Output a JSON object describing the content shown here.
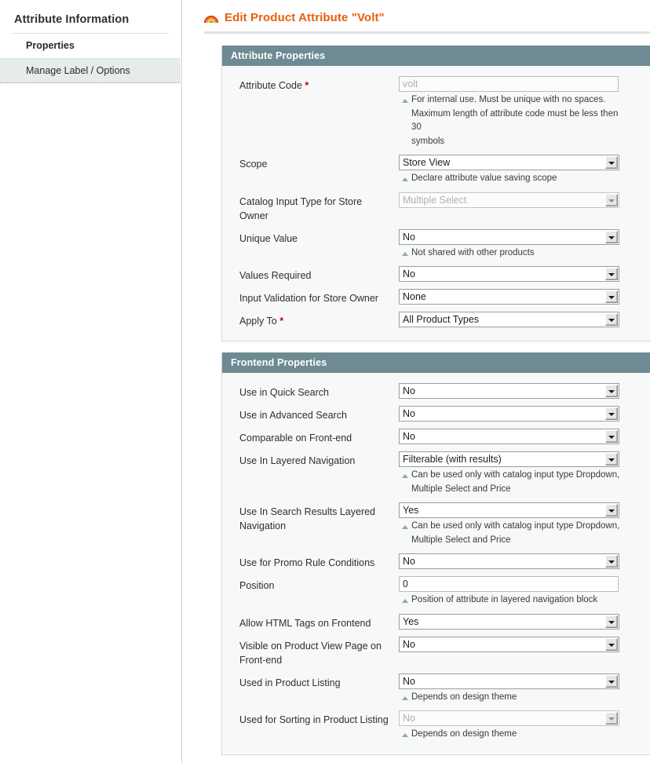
{
  "sidebar": {
    "title": "Attribute Information",
    "items": [
      {
        "label": "Properties",
        "state": "current"
      },
      {
        "label": "Manage Label / Options",
        "state": "active"
      }
    ]
  },
  "header": {
    "icon": "rainbow-icon",
    "title": "Edit Product Attribute \"Volt\"",
    "title_color": "#e8600c"
  },
  "panels": [
    {
      "title": "Attribute Properties",
      "rows": [
        {
          "label": "Attribute Code",
          "required": true,
          "control": "text",
          "value": "volt",
          "disabled": true,
          "notes": [
            "For internal use. Must be unique with no spaces.",
            "Maximum length of attribute code must be less then 30",
            "symbols"
          ]
        },
        {
          "label": "Scope",
          "required": false,
          "control": "select",
          "value": "Store View",
          "disabled": false,
          "notes": [
            "Declare attribute value saving scope"
          ]
        },
        {
          "label": "Catalog Input Type for Store Owner",
          "required": false,
          "control": "select",
          "value": "Multiple Select",
          "disabled": true,
          "notes": []
        },
        {
          "label": "Unique Value",
          "required": false,
          "control": "select",
          "value": "No",
          "disabled": false,
          "notes": [
            "Not shared with other products"
          ]
        },
        {
          "label": "Values Required",
          "required": false,
          "control": "select",
          "value": "No",
          "disabled": false,
          "notes": []
        },
        {
          "label": "Input Validation for Store Owner",
          "required": false,
          "control": "select",
          "value": "None",
          "disabled": false,
          "notes": []
        },
        {
          "label": "Apply To",
          "required": true,
          "control": "select",
          "value": "All Product Types",
          "disabled": false,
          "notes": []
        }
      ]
    },
    {
      "title": "Frontend Properties",
      "rows": [
        {
          "label": "Use in Quick Search",
          "required": false,
          "control": "select",
          "value": "No",
          "disabled": false,
          "notes": []
        },
        {
          "label": "Use in Advanced Search",
          "required": false,
          "control": "select",
          "value": "No",
          "disabled": false,
          "notes": []
        },
        {
          "label": "Comparable on Front-end",
          "required": false,
          "control": "select",
          "value": "No",
          "disabled": false,
          "notes": []
        },
        {
          "label": "Use In Layered Navigation",
          "required": false,
          "control": "select",
          "value": "Filterable (with results)",
          "disabled": false,
          "notes": [
            "Can be used only with catalog input type Dropdown,",
            "Multiple Select and Price"
          ]
        },
        {
          "label": "Use In Search Results Layered Navigation",
          "required": false,
          "control": "select",
          "value": "Yes",
          "disabled": false,
          "notes": [
            "Can be used only with catalog input type Dropdown,",
            "Multiple Select and Price"
          ]
        },
        {
          "label": "Use for Promo Rule Conditions",
          "required": false,
          "control": "select",
          "value": "No",
          "disabled": false,
          "notes": []
        },
        {
          "label": "Position",
          "required": false,
          "control": "text",
          "value": "0",
          "disabled": false,
          "notes": [
            "Position of attribute in layered navigation block"
          ]
        },
        {
          "label": "Allow HTML Tags on Frontend",
          "required": false,
          "control": "select",
          "value": "Yes",
          "disabled": false,
          "notes": []
        },
        {
          "label": "Visible on Product View Page on Front-end",
          "required": false,
          "control": "select",
          "value": "No",
          "disabled": false,
          "notes": []
        },
        {
          "label": "Used in Product Listing",
          "required": false,
          "control": "select",
          "value": "No",
          "disabled": false,
          "notes": [
            "Depends on design theme"
          ]
        },
        {
          "label": "Used for Sorting in Product Listing",
          "required": false,
          "control": "select",
          "value": "No",
          "disabled": true,
          "notes": [
            "Depends on design theme"
          ]
        }
      ]
    }
  ]
}
